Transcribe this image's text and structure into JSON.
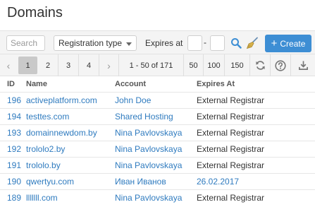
{
  "page": {
    "title": "Domains"
  },
  "toolbar": {
    "search_placeholder": "Search",
    "type_select_value": "Registration type",
    "expires_label": "Expires at",
    "date_dash": "-",
    "create_label": "Create",
    "accent_color": "#3d8ed4"
  },
  "pager": {
    "pages": [
      "1",
      "2",
      "3",
      "4"
    ],
    "active_page": "1",
    "range_text": "1 - 50 of 171",
    "page_sizes": [
      "50",
      "100",
      "150"
    ]
  },
  "table": {
    "columns": [
      "ID",
      "Name",
      "Account",
      "Expires At"
    ],
    "rows": [
      {
        "id": "196",
        "name": "activeplatform.com",
        "account": "John Doe",
        "expires": "External Registrar"
      },
      {
        "id": "194",
        "name": "testtes.com",
        "account": "Shared Hosting",
        "expires": "External Registrar"
      },
      {
        "id": "193",
        "name": "domainnewdom.by",
        "account": "Nina Pavlovskaya",
        "expires": "External Registrar"
      },
      {
        "id": "192",
        "name": "trololo2.by",
        "account": "Nina Pavlovskaya",
        "expires": "External Registrar"
      },
      {
        "id": "191",
        "name": "trololo.by",
        "account": "Nina Pavlovskaya",
        "expires": "External Registrar"
      },
      {
        "id": "190",
        "name": "qwertyu.com",
        "account": "Иван Иванов",
        "expires": "26.02.2017"
      },
      {
        "id": "189",
        "name": "lllllll.com",
        "account": "Nina Pavlovskaya",
        "expires": "External Registrar"
      }
    ]
  }
}
